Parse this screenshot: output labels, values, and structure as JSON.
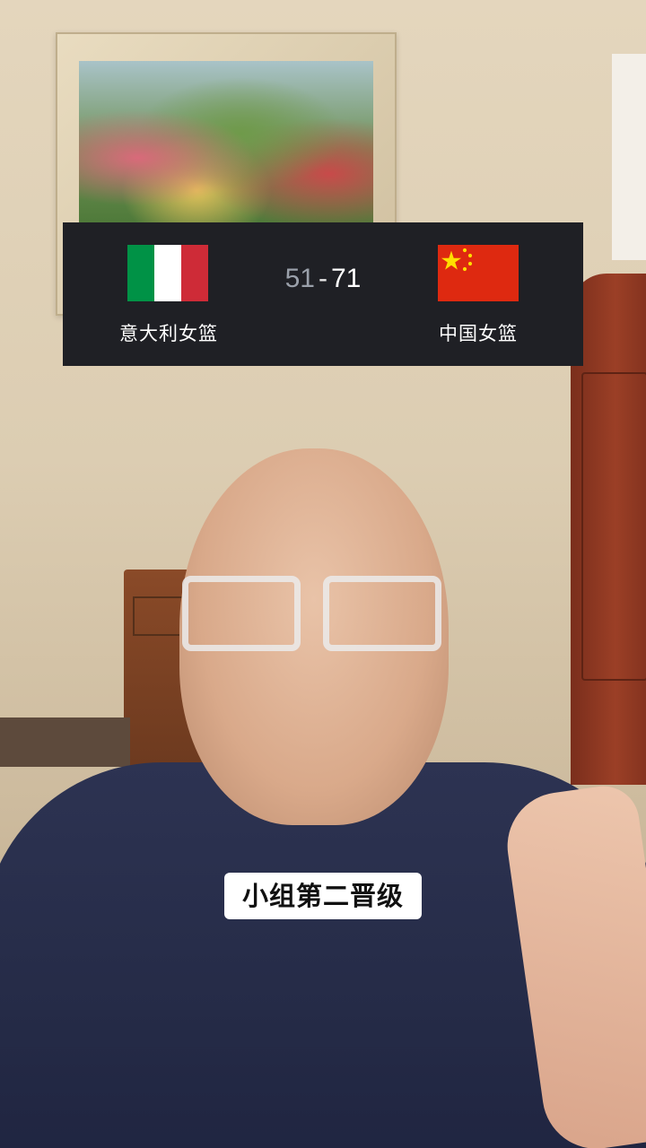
{
  "scoreboard": {
    "home": {
      "name": "意大利女篮",
      "flag_icon": "italy-flag",
      "score": "51"
    },
    "separator": "-",
    "away": {
      "name": "中国女篮",
      "flag_icon": "china-flag",
      "score": "71"
    },
    "colors": {
      "background": "#1f2025",
      "home_score": "#9aa0aa",
      "away_score": "#ffffff"
    }
  },
  "caption": {
    "text": "小组第二晋级"
  }
}
